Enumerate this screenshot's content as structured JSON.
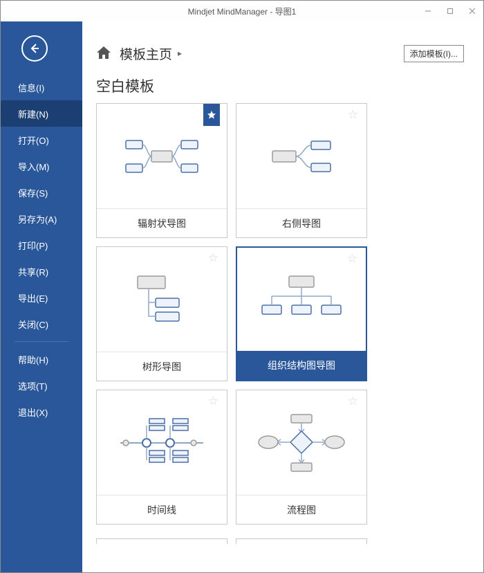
{
  "window": {
    "title": "Mindjet MindManager - 导图1"
  },
  "sidebar": {
    "items": [
      {
        "label": "信息(I)",
        "active": false
      },
      {
        "label": "新建(N)",
        "active": true
      },
      {
        "label": "打开(O)",
        "active": false
      },
      {
        "label": "导入(M)",
        "active": false
      },
      {
        "label": "保存(S)",
        "active": false
      },
      {
        "label": "另存为(A)",
        "active": false
      },
      {
        "label": "打印(P)",
        "active": false
      },
      {
        "label": "共享(R)",
        "active": false
      },
      {
        "label": "导出(E)",
        "active": false
      },
      {
        "label": "关闭(C)",
        "active": false
      }
    ],
    "bottom_items": [
      {
        "label": "帮助(H)"
      },
      {
        "label": "选项(T)"
      },
      {
        "label": "退出(X)"
      }
    ]
  },
  "breadcrumb": {
    "title": "模板主页"
  },
  "add_template_button": "添加模板(I)...",
  "section": {
    "title": "空白模板"
  },
  "templates": [
    {
      "label": "辐射状导图",
      "favorite": true,
      "selected": false,
      "icon": "radial"
    },
    {
      "label": "右侧导图",
      "favorite": false,
      "selected": false,
      "icon": "right"
    },
    {
      "label": "树形导图",
      "favorite": false,
      "selected": false,
      "icon": "tree"
    },
    {
      "label": "组织结构图导图",
      "favorite": false,
      "selected": true,
      "icon": "org"
    },
    {
      "label": "时间线",
      "favorite": false,
      "selected": false,
      "icon": "timeline"
    },
    {
      "label": "流程图",
      "favorite": false,
      "selected": false,
      "icon": "flowchart"
    }
  ]
}
